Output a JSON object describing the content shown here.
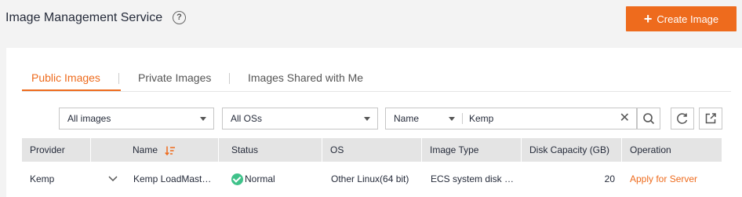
{
  "header": {
    "title": "Image Management Service",
    "help": "?",
    "create_label": "Create Image"
  },
  "tabs": [
    "Public Images",
    "Private Images",
    "Images Shared with Me"
  ],
  "filters": {
    "image_type": "All images",
    "os": "All OSs",
    "search_field": "Name",
    "search_value": "Kemp"
  },
  "table": {
    "headers": [
      "Provider",
      "Name",
      "Status",
      "OS",
      "Image Type",
      "Disk Capacity (GB)",
      "Operation"
    ],
    "rows": [
      {
        "provider": "Kemp",
        "name": "Kemp LoadMast…",
        "status": "Normal",
        "os": "Other Linux(64 bit)",
        "image_type": "ECS system disk …",
        "disk": "20",
        "operation": "Apply for Server"
      }
    ]
  },
  "colors": {
    "accent": "#ee6b1d",
    "status_ok": "#3fc28a"
  }
}
